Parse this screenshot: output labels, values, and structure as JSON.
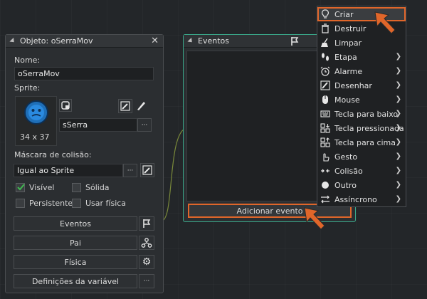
{
  "object_panel": {
    "title": "Objeto: oSerraMov",
    "name_label": "Nome:",
    "name_value": "oSerraMov",
    "sprite_label": "Sprite:",
    "sprite_size": "34 x 37",
    "sprite_name": "sSerra",
    "ellipsis": "···",
    "mask_label": "Máscara de colisão:",
    "mask_value": "Igual ao Sprite",
    "checkboxes": [
      {
        "label": "Visível",
        "checked": true
      },
      {
        "label": "Sólida",
        "checked": false
      },
      {
        "label": "Persistente",
        "checked": false
      },
      {
        "label": "Usar física",
        "checked": false
      }
    ],
    "buttons": {
      "events": "Eventos",
      "parent": "Pai",
      "physics": "Física",
      "variables": "Definições da variável"
    }
  },
  "events_panel": {
    "title": "Eventos",
    "add_event_label": "Adicionar evento"
  },
  "event_menu": {
    "items": [
      {
        "label": "Criar",
        "icon": "lightbulb-icon",
        "submenu": false
      },
      {
        "label": "Destruir",
        "icon": "trash-icon",
        "submenu": false
      },
      {
        "label": "Limpar",
        "icon": "broom-icon",
        "submenu": false
      },
      {
        "label": "Etapa",
        "icon": "footsteps-icon",
        "submenu": true
      },
      {
        "label": "Alarme",
        "icon": "alarm-clock-icon",
        "submenu": true
      },
      {
        "label": "Desenhar",
        "icon": "paintbrush-icon",
        "submenu": true
      },
      {
        "label": "Mouse",
        "icon": "mouse-icon",
        "submenu": true
      },
      {
        "label": "Tecla para baixo",
        "icon": "keyboard-icon",
        "submenu": true
      },
      {
        "label": "Tecla pressionada",
        "icon": "key-down-icon",
        "submenu": true
      },
      {
        "label": "Tecla para cima",
        "icon": "key-up-icon",
        "submenu": true
      },
      {
        "label": "Gesto",
        "icon": "hand-icon",
        "submenu": true
      },
      {
        "label": "Colisão",
        "icon": "collision-icon",
        "submenu": true
      },
      {
        "label": "Outro",
        "icon": "circle-icon",
        "submenu": true
      },
      {
        "label": "Assíncrono",
        "icon": "async-arrows-icon",
        "submenu": true
      }
    ]
  },
  "colors": {
    "highlight": "#e0662a",
    "events_panel_accent": "#3aa88a"
  }
}
